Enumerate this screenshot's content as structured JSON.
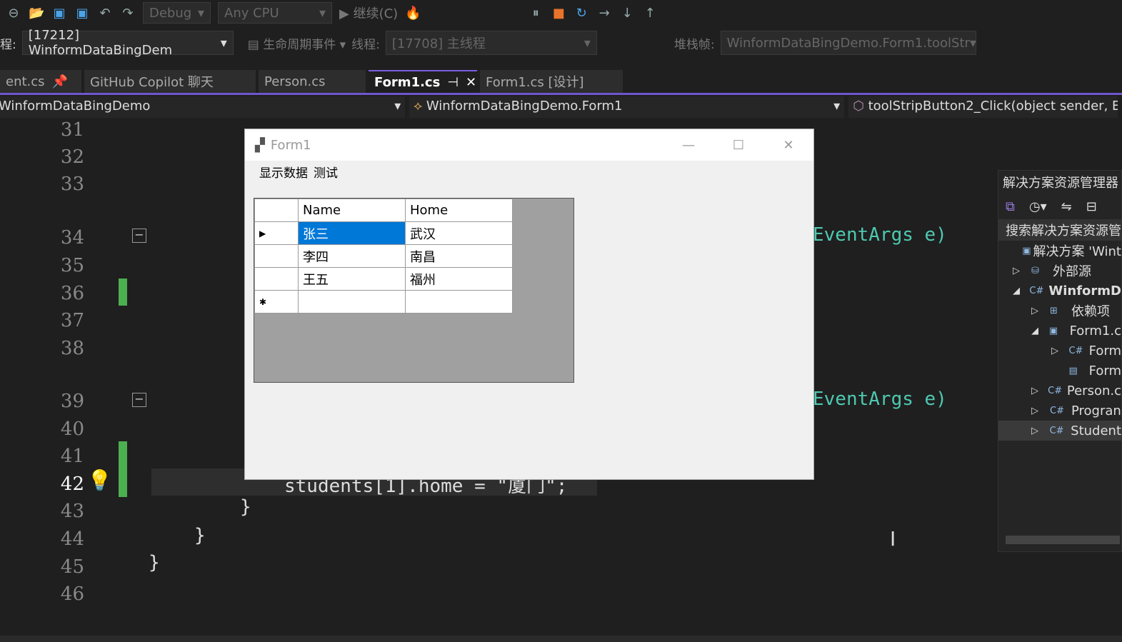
{
  "toolbar": {
    "config": "Debug",
    "platform": "Any CPU",
    "continue": "继续(C)"
  },
  "debug": {
    "process_label": "程:",
    "process": "[17212] WinformDataBingDem",
    "lifecycle": "生命周期事件",
    "thread_label": "线程:",
    "thread": "[17708] 主线程",
    "stack_label": "堆栈帧:",
    "stack": "WinformDataBingDemo.Form1.toolStr"
  },
  "tabs": [
    {
      "label": "ent.cs"
    },
    {
      "label": "GitHub Copilot 聊天"
    },
    {
      "label": "Person.cs"
    },
    {
      "label": "Form1.cs"
    },
    {
      "label": "Form1.cs [设计]"
    }
  ],
  "nav": {
    "project": "WinformDataBingDemo",
    "class": "WinformDataBingDemo.Form1",
    "member": "toolStripButton2_Click(object sender, Ev"
  },
  "editor": {
    "lines": [
      "31",
      "32",
      "33",
      "34",
      "35",
      "36",
      "37",
      "38",
      "39",
      "40",
      "41",
      "42",
      "43",
      "44",
      "45",
      "46"
    ],
    "code_line": "students[1].home = \"厦门\";",
    "eventargs": "EventArgs e)"
  },
  "form": {
    "title": "Form1",
    "menu": [
      "显示数据",
      "测试"
    ],
    "columns": [
      "Name",
      "Home"
    ],
    "rows": [
      [
        "张三",
        "武汉"
      ],
      [
        "李四",
        "南昌"
      ],
      [
        "王五",
        "福州"
      ]
    ]
  },
  "solution_explorer": {
    "title": "解决方案资源管理器",
    "search": "搜索解决方案资源管",
    "items": [
      "解决方案 'Wint",
      "外部源",
      "WinformD",
      "依赖项",
      "Form1.c",
      "Form",
      "Form",
      "Person.c",
      "Progran",
      "Student"
    ]
  }
}
